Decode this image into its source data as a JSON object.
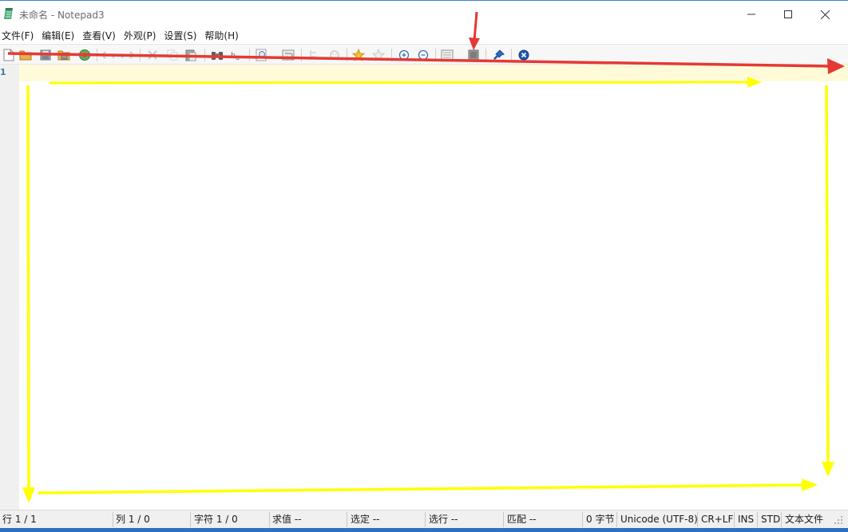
{
  "window": {
    "title": "未命名 - Notepad3",
    "controls": {
      "minimize": "—",
      "maximize": "☐",
      "close": "✕"
    }
  },
  "menu": {
    "items": [
      "文件(F)",
      "编辑(E)",
      "查看(V)",
      "外观(P)",
      "设置(S)",
      "帮助(H)"
    ]
  },
  "toolbar": {
    "buttons": [
      "new-file",
      "open-file",
      "save-file",
      "save-as",
      "browse",
      "undo",
      "redo",
      "cut",
      "copy",
      "paste",
      "find",
      "replace",
      "goto",
      "word-wrap",
      "mark-occurrences",
      "view-whitespace",
      "favorite-add",
      "favorite-remove",
      "zoom-in",
      "zoom-out",
      "schemes",
      "customize-schemes",
      "always-on-top",
      "exit"
    ]
  },
  "editor": {
    "line_number": "1"
  },
  "status": {
    "line": "行  1 / 1",
    "column": "列  1 / 0",
    "character": "字符  1 / 0",
    "sum": "求值  --",
    "selection": "选定  --",
    "selected_lines": "选行  --",
    "match": "匹配  --",
    "bytes": "0 字节",
    "encoding": "Unicode (UTF-8)",
    "eol": "CR+LF",
    "ins": "INS",
    "std": "STD",
    "lexer": "文本文件"
  },
  "colors": {
    "current_line": "#fffbd9",
    "annotation_red": "#e53935",
    "annotation_yellow": "#ffff00",
    "line_number": "#3a7d9a"
  }
}
